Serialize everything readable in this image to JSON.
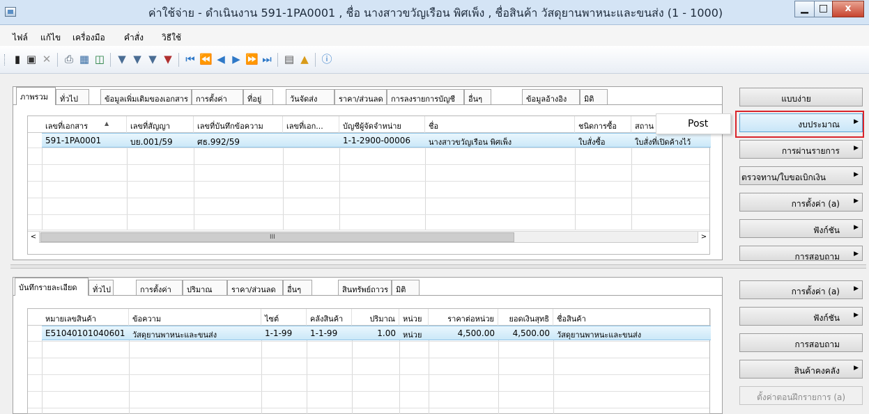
{
  "window": {
    "title": "ค่าใช้จ่าย - ดำเนินงาน 591-1PA0001 , ชื่อ นางสาวขวัญเรือน พิศเพ็ง , ชื่อสินค้า วัสดุยานพาหนะและขนส่ง (1 - 1000)",
    "minimize": "▁",
    "maximize": "□",
    "close": "x"
  },
  "menu": [
    "ไฟล์",
    "แก้ไข",
    "เครื่องมือ",
    "คำสั่ง",
    "วิธีใช้"
  ],
  "toolbar": {
    "icons": [
      "new-icon",
      "save-icon",
      "delete-icon",
      "print-icon",
      "print-preview-icon",
      "excel-icon",
      "filter-icon",
      "filter-by-selection-icon",
      "advanced-filter-icon",
      "clear-filter-icon",
      "first-record-icon",
      "previous-page-icon",
      "previous-record-icon",
      "next-record-icon",
      "next-page-icon",
      "last-record-icon",
      "attachments-icon",
      "alert-icon",
      "help-icon"
    ]
  },
  "colors": {
    "highlight_border": "#d9242b",
    "selected_row": "#cbe8f8",
    "title_bar": "#d4e4f5",
    "close_button": "#c7442f"
  },
  "header_tabs": [
    "ภาพรวม",
    "ทั่วไป",
    "ข้อมูลเพิ่มเติมของเอกสาร",
    "การตั้งค่า",
    "ที่อยู่",
    "วันจัดส่ง",
    "ราคา/ส่วนลด",
    "การลงรายการบัญชี",
    "อื่นๆ",
    "ข้อมูลอ้างอิง",
    "มิติ"
  ],
  "header_grid": {
    "columns": [
      "เลขที่เอกสาร",
      "เลขที่สัญญา",
      "เลขที่บันทึกข้อความ",
      "เลขที่เอก...",
      "บัญชีผู้จัดจำหน่าย",
      "ชื่อ",
      "ชนิดการซื้อ",
      "สถาน"
    ],
    "sort_indicator": "▲",
    "rows": [
      [
        "591-1PA0001",
        "บย.001/59",
        "ศธ.992/59",
        "",
        "1-1-2900-00006",
        "นางสาวขวัญเรือน พิศเพ็ง",
        "ใบสั่งซื้อ",
        "ใบสั่งที่เปิดค้างไว้"
      ]
    ],
    "scroll_left": "<",
    "scroll_right": ">",
    "scroll_grip": "III"
  },
  "context_menu": {
    "items": [
      "Post"
    ]
  },
  "header_buttons": [
    {
      "label": "แบบง่าย",
      "arrow": ""
    },
    {
      "label": "งบประมาณ",
      "arrow": "▶"
    },
    {
      "label": "การผ่านรายการ",
      "arrow": "▶"
    },
    {
      "label": "ตรวจทาน/ใบขอเบิกเงิน",
      "arrow": "▶"
    },
    {
      "label": "การตั้งค่า (a)",
      "arrow": "▶"
    },
    {
      "label": "ฟังก์ชัน",
      "arrow": "▶"
    },
    {
      "label": "การสอบถาม",
      "arrow": "▶"
    }
  ],
  "line_tabs": [
    "บันทึกรายละเอียด",
    "ทั่วไป",
    "การตั้งค่า",
    "ปริมาณ",
    "ราคา/ส่วนลด",
    "อื่นๆ",
    "สินทรัพย์ถาวร",
    "มิติ"
  ],
  "line_grid": {
    "columns": [
      "หมายเลขสินค้า",
      "ข้อความ",
      "ไซต์",
      "คลังสินค้า",
      "ปริมาณ",
      "หน่วย",
      "ราคาต่อหน่วย",
      "ยอดเงินสุทธิ",
      "ชื่อสินค้า"
    ],
    "rows": [
      [
        "E51040101040601",
        "วัสดุยานพาหนะและขนส่ง",
        "1-1-99",
        "1-1-99",
        "1.00",
        "หน่วย",
        "4,500.00",
        "4,500.00",
        "วัสดุยานพาหนะและขนส่ง"
      ]
    ]
  },
  "line_buttons": [
    {
      "label": "การตั้งค่า (a)",
      "arrow": "▶"
    },
    {
      "label": "ฟังก์ชัน",
      "arrow": "▶"
    },
    {
      "label": "การสอบถาม",
      "arrow": ""
    },
    {
      "label": "สินค้าคงคลัง",
      "arrow": "▶"
    },
    {
      "label": "ตั้งค่าตอนฝึกรายการ (a)",
      "arrow": ""
    }
  ]
}
